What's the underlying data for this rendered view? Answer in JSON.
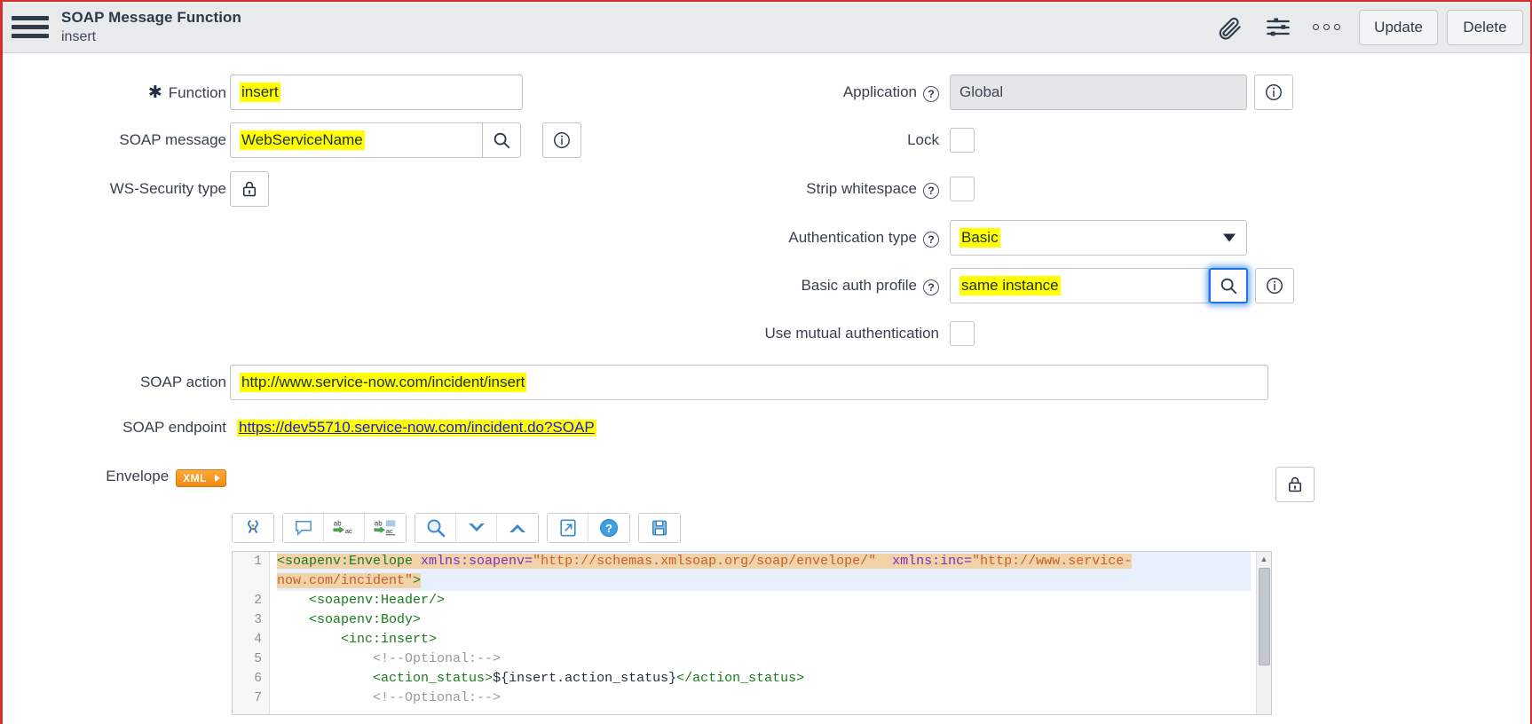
{
  "header": {
    "title": "SOAP Message Function",
    "subtitle": "insert",
    "menu_icon": "hamburger-icon",
    "attachment_icon": "paperclip-icon",
    "personalize_icon": "sliders-icon",
    "more_icon": "three-dots-icon",
    "update_label": "Update",
    "delete_label": "Delete"
  },
  "form": {
    "function": {
      "label": "Function",
      "value": "insert",
      "required": "✱"
    },
    "soap_message": {
      "label": "SOAP message",
      "value": "WebServiceName",
      "search_icon": "search-icon",
      "info_icon": "info-icon"
    },
    "ws_security_type": {
      "label": "WS-Security type",
      "lock_icon": "lock-icon"
    },
    "application": {
      "label": "Application",
      "value": "Global",
      "help": "?",
      "info_icon": "info-icon"
    },
    "lock": {
      "label": "Lock",
      "checked": false
    },
    "strip_whitespace": {
      "label": "Strip whitespace",
      "help": "?",
      "checked": false
    },
    "authentication_type": {
      "label": "Authentication type",
      "help": "?",
      "value": "Basic",
      "options": [
        "Basic"
      ]
    },
    "basic_auth_profile": {
      "label": "Basic auth profile",
      "help": "?",
      "value": "same instance",
      "search_icon": "search-icon",
      "info_icon": "info-icon"
    },
    "use_mutual_authentication": {
      "label": "Use mutual authentication",
      "checked": false
    },
    "soap_action": {
      "label": "SOAP action",
      "value": "http://www.service-now.com/incident/insert"
    },
    "soap_endpoint": {
      "label": "SOAP endpoint",
      "value": "https://dev55710.service-now.com/incident.do?SOAP",
      "lock_icon": "lock-icon"
    },
    "envelope": {
      "label": "Envelope",
      "badge": "XML"
    }
  },
  "editor": {
    "toolbar": [
      {
        "name": "syntax-check-icon"
      },
      {
        "name": "comment-icon"
      },
      {
        "name": "replace-icon"
      },
      {
        "name": "replace-all-icon"
      },
      {
        "name": "search-icon"
      },
      {
        "name": "find-next-icon"
      },
      {
        "name": "find-previous-icon"
      },
      {
        "name": "expand-icon"
      },
      {
        "name": "help-icon"
      },
      {
        "name": "save-icon"
      }
    ],
    "line_numbers": [
      "1",
      "2",
      "3",
      "4",
      "5",
      "6",
      "7"
    ],
    "lines": [
      {
        "n": "1",
        "active": true,
        "parts": [
          {
            "t": "<soapenv:Envelope ",
            "c": "tg tagbg"
          },
          {
            "t": "xmlns:soapenv=",
            "c": "at tagbg"
          },
          {
            "t": "\"http://schemas.xmlsoap.org/soap/envelope/\"",
            "c": "av tagbg"
          },
          {
            "t": "  ",
            "c": "tagbg"
          },
          {
            "t": "xmlns:inc=",
            "c": "at tagbg"
          },
          {
            "t": "\"http://www.service-now.com/incident\"",
            "c": "av tagbg"
          },
          {
            "t": ">",
            "c": "tg tagbg"
          }
        ]
      },
      {
        "n": "2",
        "active": false,
        "parts": [
          {
            "t": "    ",
            "c": ""
          },
          {
            "t": "<soapenv:Header/>",
            "c": "tg"
          }
        ]
      },
      {
        "n": "3",
        "active": false,
        "parts": [
          {
            "t": "    ",
            "c": ""
          },
          {
            "t": "<soapenv:Body>",
            "c": "tg"
          }
        ]
      },
      {
        "n": "4",
        "active": false,
        "parts": [
          {
            "t": "        ",
            "c": ""
          },
          {
            "t": "<inc:insert>",
            "c": "tg"
          }
        ]
      },
      {
        "n": "5",
        "active": false,
        "parts": [
          {
            "t": "            ",
            "c": ""
          },
          {
            "t": "<!--Optional:-->",
            "c": "cm"
          }
        ]
      },
      {
        "n": "6",
        "active": false,
        "parts": [
          {
            "t": "            ",
            "c": ""
          },
          {
            "t": "<action_status>",
            "c": "tg"
          },
          {
            "t": "${insert.action_status}",
            "c": "var"
          },
          {
            "t": "</action_status>",
            "c": "tg"
          }
        ]
      },
      {
        "n": "7",
        "active": false,
        "parts": [
          {
            "t": "            ",
            "c": ""
          },
          {
            "t": "<!--Optional:-->",
            "c": "cm"
          }
        ]
      }
    ]
  }
}
